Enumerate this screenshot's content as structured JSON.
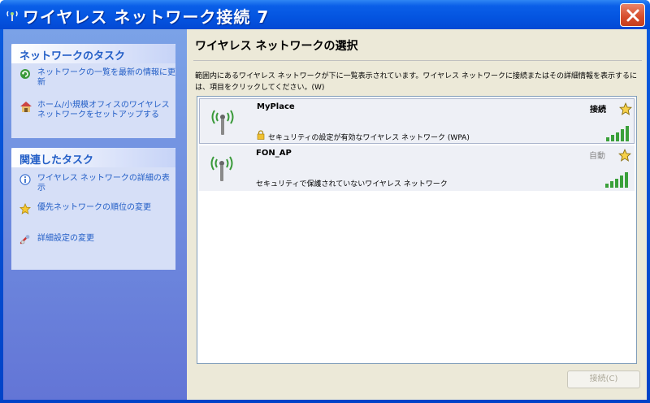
{
  "window": {
    "title": "ワイヤレス ネットワーク接続 7"
  },
  "sidebar": {
    "network_tasks": {
      "header": "ネットワークのタスク",
      "items": [
        {
          "label": "ネットワークの一覧を最新の情報に更新",
          "icon": "refresh-icon"
        },
        {
          "label": "ホーム/小規模オフィスのワイヤレス ネットワークをセットアップする",
          "icon": "home-network-icon"
        }
      ]
    },
    "related_tasks": {
      "header": "関連したタスク",
      "items": [
        {
          "label": "ワイヤレス ネットワークの詳細の表示",
          "icon": "info-icon"
        },
        {
          "label": "優先ネットワークの順位の変更",
          "icon": "star-icon"
        },
        {
          "label": "詳細設定の変更",
          "icon": "settings-icon"
        }
      ]
    }
  },
  "main": {
    "title": "ワイヤレス ネットワークの選択",
    "description": "範囲内にあるワイヤレス ネットワークが下に一覧表示されています。ワイヤレス ネットワークに接続またはその詳細情報を表示するには、項目をクリックしてください。(W)",
    "networks": [
      {
        "name": "MyPlace",
        "status": "接続",
        "security": "セキュリティの設定が有効なワイヤレス ネットワーク (WPA)",
        "secured": true,
        "signal_bars": 5,
        "preferred": true
      },
      {
        "name": "FON_AP",
        "status": "自動",
        "security": "セキュリティで保護されていないワイヤレス ネットワーク",
        "secured": false,
        "signal_bars": 5,
        "preferred": true
      }
    ],
    "connect_button": "接続(C)"
  },
  "colors": {
    "titlebar": "#0454e0",
    "sidebar_link": "#215dc6",
    "close_button": "#d64c2a"
  }
}
